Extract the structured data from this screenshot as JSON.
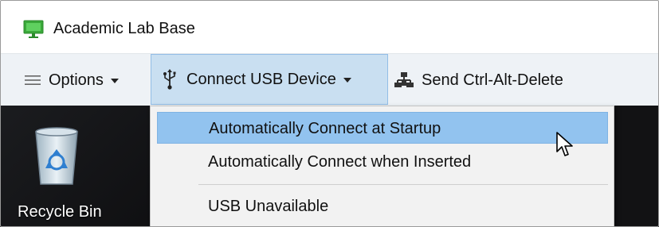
{
  "window": {
    "title": "Academic Lab Base",
    "icon": "monitor-icon",
    "accent": "#3aa83a"
  },
  "toolbar": {
    "options": {
      "icon": "hamburger-icon",
      "label": "Options"
    },
    "connect_usb": {
      "icon": "usb-icon",
      "label": "Connect USB Device",
      "highlight": "#c9dff1"
    },
    "send_cad": {
      "icon": "network-icon",
      "label": "Send Ctrl-Alt-Delete"
    }
  },
  "menu": {
    "items": [
      {
        "label": "Automatically Connect at Startup",
        "highlighted": true
      },
      {
        "label": "Automatically Connect when Inserted"
      },
      {
        "label": "USB Unavailable"
      }
    ],
    "highlight_color": "#92c3ef"
  },
  "desktop": {
    "recycle_bin": {
      "label": "Recycle Bin",
      "icon": "recycle-bin-icon"
    }
  }
}
